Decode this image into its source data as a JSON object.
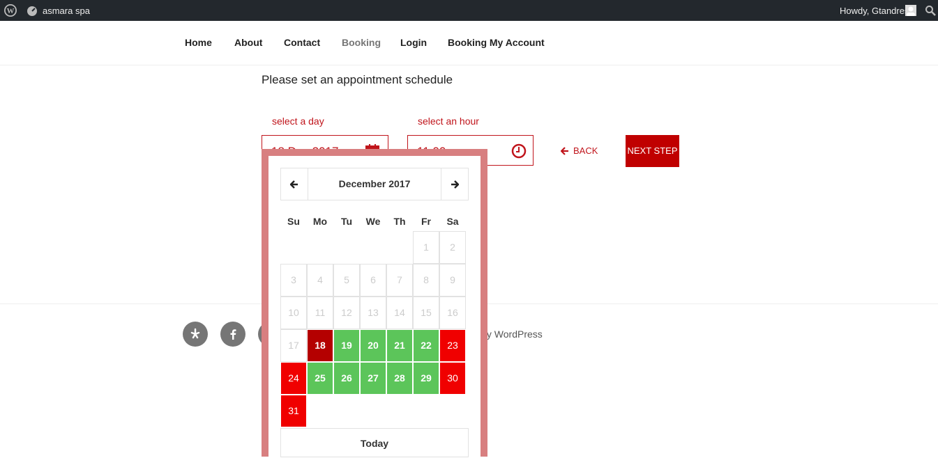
{
  "adminbar": {
    "site_name": "asmara spa",
    "howdy": "Howdy, Gtandres"
  },
  "nav": {
    "items": [
      {
        "label": "Home"
      },
      {
        "label": "About"
      },
      {
        "label": "Contact"
      },
      {
        "label": "Booking",
        "active": true
      },
      {
        "label": "Login"
      },
      {
        "label": "Booking My Account"
      }
    ]
  },
  "booking": {
    "headline": "Please set an appointment schedule",
    "day_label": "select a day",
    "day_value": "18 Dec 2017",
    "hour_label": "select an hour",
    "hour_value": "11:00pm",
    "back_label": "BACK",
    "next_label": "NEXT STEP"
  },
  "footer": {
    "powered": "red by WordPress"
  },
  "datepicker": {
    "month_title": "December 2017",
    "weekdays": [
      "Su",
      "Mo",
      "Tu",
      "We",
      "Th",
      "Fr",
      "Sa"
    ],
    "days": [
      "1",
      "2",
      "3",
      "4",
      "5",
      "6",
      "7",
      "8",
      "9",
      "10",
      "11",
      "12",
      "13",
      "14",
      "15",
      "16",
      "17",
      "18",
      "19",
      "20",
      "21",
      "22",
      "23",
      "24",
      "25",
      "26",
      "27",
      "28",
      "29",
      "30",
      "31"
    ],
    "today_label": "Today"
  },
  "colors": {
    "accent": "#c0141b",
    "available": "#5cc55a",
    "unavailable": "#f00000",
    "selected": "#b40000",
    "picker_border": "#d87f80"
  }
}
